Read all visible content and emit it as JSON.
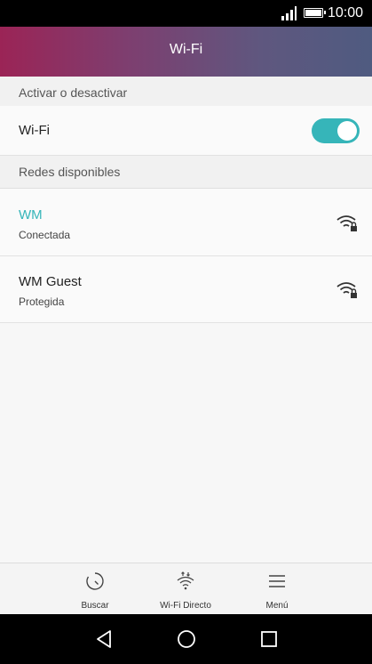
{
  "status_bar": {
    "time": "10:00",
    "signal_icon": "signal-icon",
    "battery_icon": "battery-icon"
  },
  "app_bar": {
    "title": "Wi-Fi"
  },
  "sections": {
    "toggle_header": "Activar o desactivar",
    "networks_header": "Redes disponibles"
  },
  "wifi_toggle": {
    "label": "Wi-Fi",
    "state": "on",
    "accent_color": "#36b5b9"
  },
  "networks": [
    {
      "name": "WM",
      "status": "Conectada",
      "name_color": "#36b5b9",
      "icon": "wifi-lock-icon"
    },
    {
      "name": "WM Guest",
      "status": "Protegida",
      "name_color": "#222222",
      "icon": "wifi-lock-icon"
    }
  ],
  "bottom_bar": {
    "items": [
      {
        "label": "Buscar",
        "icon": "refresh-icon"
      },
      {
        "label": "Wi-Fi Directo",
        "icon": "wifi-direct-icon"
      },
      {
        "label": "Menú",
        "icon": "menu-icon"
      }
    ]
  },
  "nav_bar": {
    "back": "back-icon",
    "home": "home-icon",
    "recents": "recents-icon"
  }
}
